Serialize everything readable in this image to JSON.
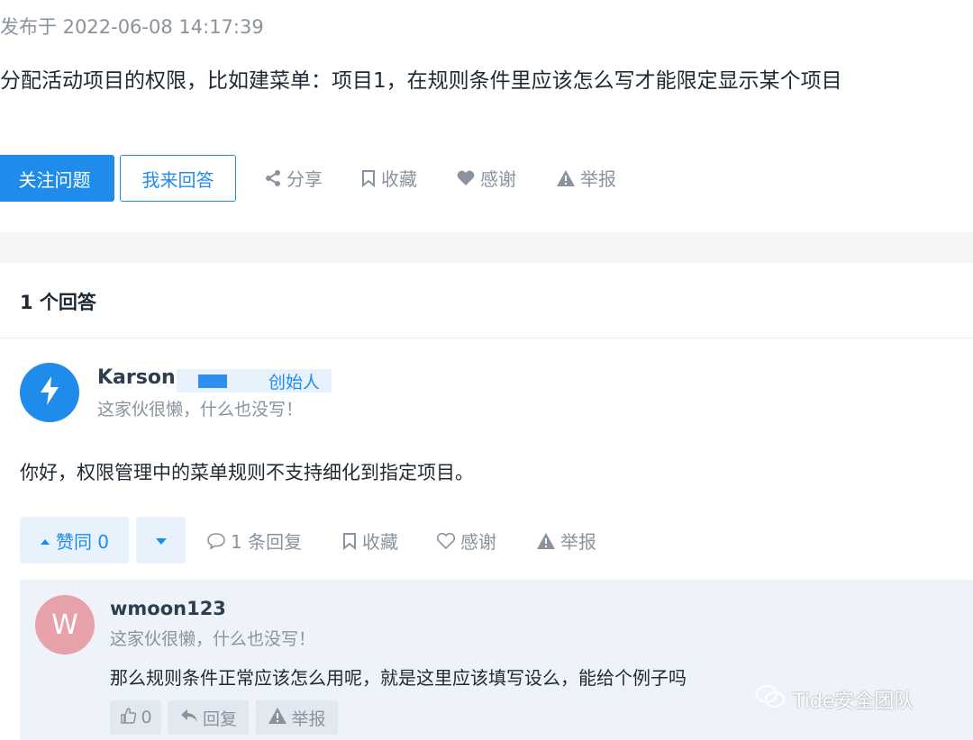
{
  "question": {
    "published": "发布于 2022-06-08 14:17:39",
    "text": "分配活动项目的权限，比如建菜单：项目1，在规则条件里应该怎么写才能限定显示某个项目"
  },
  "actions": {
    "follow": "关注问题",
    "answer": "我来回答",
    "share": "分享",
    "favorite": "收藏",
    "thanks": "感谢",
    "report": "举报"
  },
  "answers": {
    "count_label": "1 个回答",
    "author": "Karson",
    "role": "创始人",
    "bio": "这家伙很懒，什么也没写！",
    "content": "你好，权限管理中的菜单规则不支持细化到指定项目。",
    "vote_label": "赞同 0",
    "replies": "1 条回复",
    "favorite": "收藏",
    "thanks": "感谢",
    "report": "举报"
  },
  "reply": {
    "avatar_letter": "W",
    "author": "wmoon123",
    "bio": "这家伙很懒，什么也没写！",
    "content": "那么规则条件正常应该怎么用呢，就是这里应该填写设么，能给个例子吗",
    "like_count": "0",
    "reply_label": "回复",
    "report_label": "举报"
  },
  "watermark": "Tide安全团队",
  "icons": {
    "share": "share-icon",
    "bookmark": "bookmark-icon",
    "heart": "heart-icon",
    "warning": "warning-icon",
    "bolt": "bolt-icon",
    "comment": "comment-icon",
    "thumb": "thumb-up-icon",
    "reply": "reply-icon"
  },
  "colors": {
    "primary": "#1f8ceb",
    "muted": "#8a939d",
    "panel": "#eef3f9"
  }
}
